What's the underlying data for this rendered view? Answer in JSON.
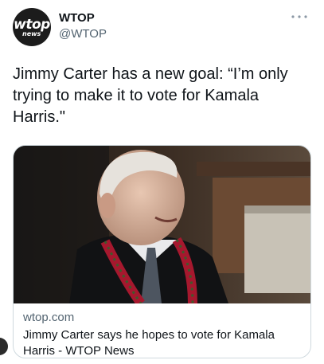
{
  "tweet": {
    "display_name": "WTOP",
    "handle": "@WTOP",
    "avatar": {
      "logo_text": "wtop",
      "logo_subtext": "news"
    },
    "more_icon": "more-horizontal-icon",
    "text": "Jimmy Carter has a new goal: “I’m only trying to make it to vote for Kamala Harris.\""
  },
  "card": {
    "domain": "wtop.com",
    "title": "Jimmy Carter says he hopes to vote for Kamala Harris - WTOP News"
  },
  "colors": {
    "text_primary": "#0f1419",
    "text_secondary": "#536471",
    "card_border": "#cfd9de"
  }
}
